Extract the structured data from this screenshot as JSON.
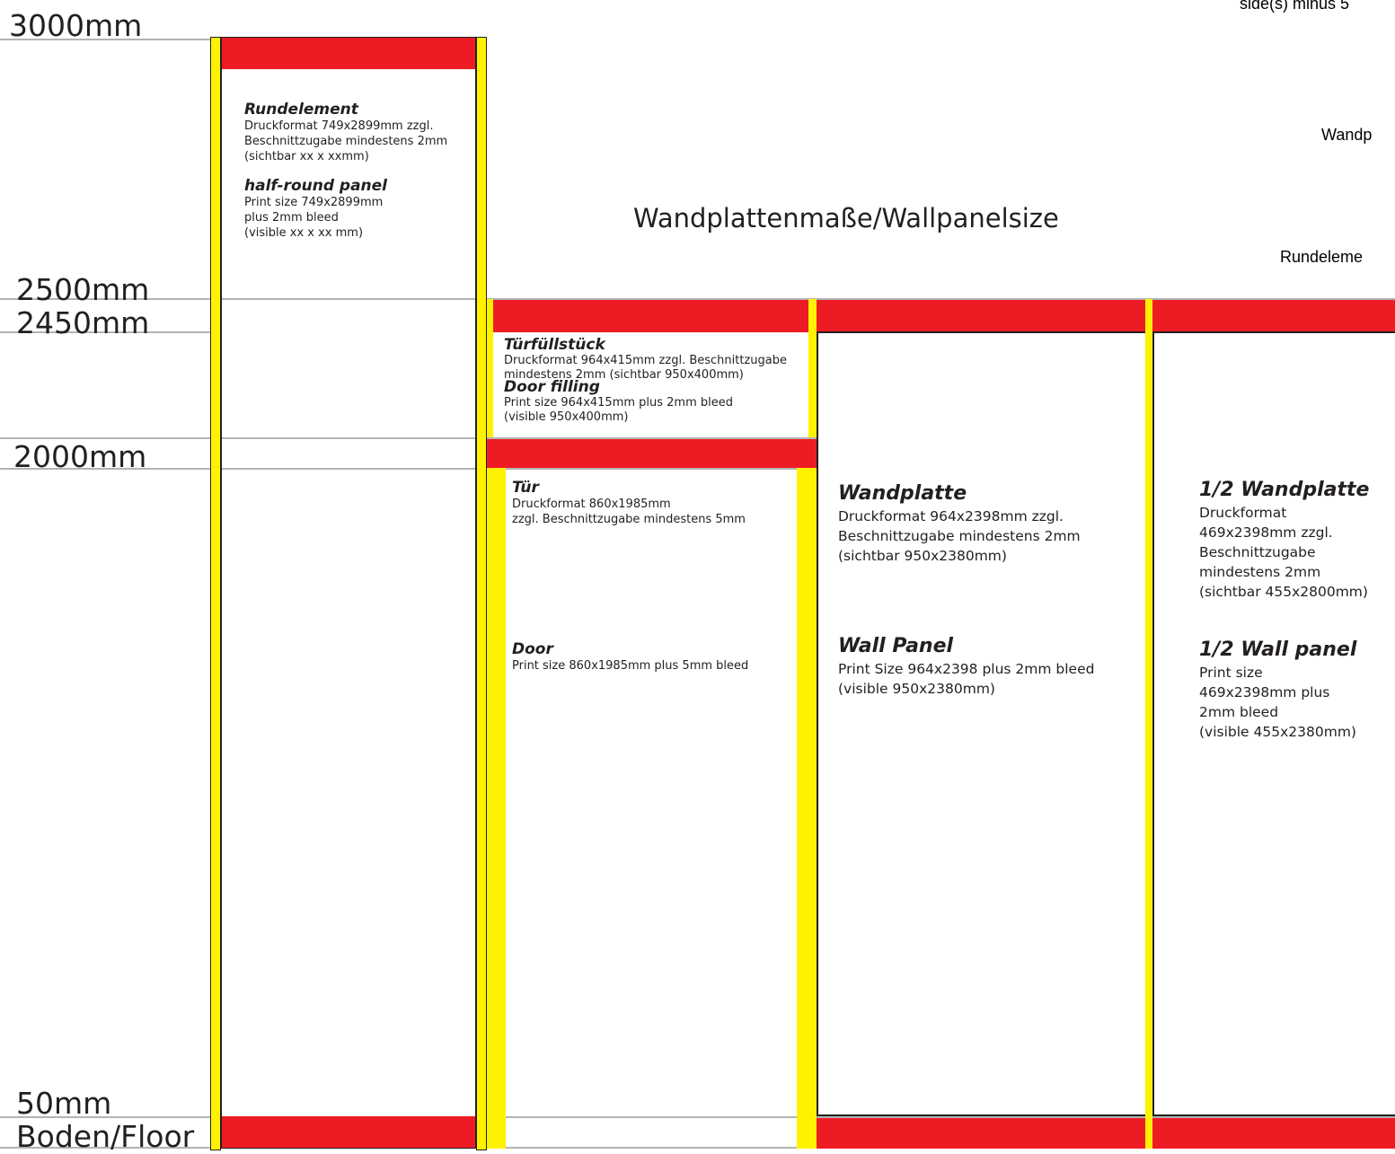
{
  "title": "Wandplattenmaße/Wallpanelsize",
  "scale": [
    "3000mm",
    "2500mm",
    "2450mm",
    "2000mm",
    "50mm",
    "Boden/Floor"
  ],
  "cut_texts": {
    "top": "side(s) minus 5",
    "mid": "Wandp",
    "low": "Rundeleme"
  },
  "panels": {
    "rundelement": {
      "de_title": "Rundelement",
      "de_lines": [
        "Druckformat 749x2899mm zzgl.",
        "Beschnittzugabe mindestens 2mm",
        "(sichtbar xx x xxmm)"
      ],
      "en_title": "half-round panel",
      "en_lines": [
        "Print size 749x2899mm",
        "plus 2mm bleed",
        "(visible xx x xx mm)"
      ]
    },
    "tuerfuellstueck": {
      "de_title": "Türfüllstück",
      "de_lines": [
        "Druckformat 964x415mm zzgl. Beschnittzugabe",
        "mindestens 2mm (sichtbar 950x400mm)"
      ],
      "en_title": "Door filling",
      "en_lines": [
        "Print size 964x415mm plus 2mm bleed",
        "(visible 950x400mm)"
      ]
    },
    "tuer": {
      "de_title": "Tür",
      "de_lines": [
        "Druckformat 860x1985mm",
        "zzgl. Beschnittzugabe mindestens 5mm"
      ],
      "en_title": "Door",
      "en_lines": [
        "Print size 860x1985mm plus 5mm bleed"
      ]
    },
    "wandplatte": {
      "de_title": "Wandplatte",
      "de_lines": [
        "Druckformat 964x2398mm zzgl.",
        "Beschnittzugabe mindestens 2mm",
        "(sichtbar 950x2380mm)"
      ],
      "en_title": "Wall Panel",
      "en_lines": [
        "Print Size 964x2398 plus 2mm bleed",
        "(visible 950x2380mm)"
      ]
    },
    "halbe_wandplatte": {
      "de_title": "1/2 Wandplatte",
      "de_lines": [
        "Druckformat",
        "469x2398mm zzgl.",
        "Beschnittzugabe",
        "mindestens 2mm",
        "(sichtbar 455x2800mm)"
      ],
      "en_title": "1/2 Wall panel",
      "en_lines": [
        "Print size",
        "469x2398mm plus",
        "2mm bleed",
        "(visible 455x2380mm)"
      ]
    }
  },
  "colors": {
    "bleed": "#ed1c24",
    "frame": "#fff200",
    "outline": "#231f20",
    "scale_line": "#b3b3b3"
  }
}
